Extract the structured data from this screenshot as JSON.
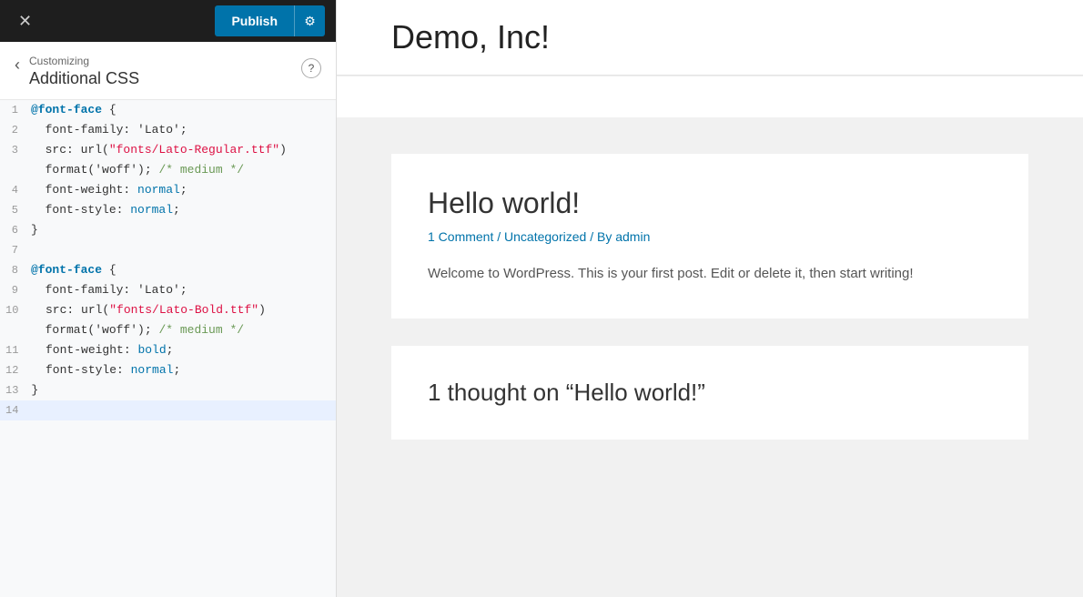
{
  "topbar": {
    "close_icon": "✕",
    "publish_label": "Publish",
    "settings_icon": "⚙"
  },
  "sidebar": {
    "customizing_label": "Customizing",
    "section_title": "Additional CSS",
    "back_icon": "‹",
    "help_icon": "?"
  },
  "code_editor": {
    "lines": [
      {
        "num": 1,
        "tokens": [
          {
            "type": "at",
            "text": "@font-face"
          },
          {
            "type": "plain",
            "text": " {"
          }
        ]
      },
      {
        "num": 2,
        "tokens": [
          {
            "type": "plain",
            "text": "  font-family: 'Lato';"
          }
        ]
      },
      {
        "num": 3,
        "tokens": [
          {
            "type": "plain",
            "text": "  src: url("
          },
          {
            "type": "string",
            "text": "\"fonts/Lato-Regular.ttf\""
          },
          {
            "type": "plain",
            "text": ")"
          },
          {
            "type": "plain",
            "text": ";"
          }
        ]
      },
      {
        "num": 3,
        "tokens": [
          {
            "type": "plain",
            "text": "  format('woff'); "
          },
          {
            "type": "comment",
            "text": "/* medium */"
          }
        ]
      },
      {
        "num": 4,
        "tokens": [
          {
            "type": "plain",
            "text": "  font-weight: "
          },
          {
            "type": "keyword",
            "text": "normal"
          },
          {
            "type": "plain",
            "text": ";"
          }
        ]
      },
      {
        "num": 5,
        "tokens": [
          {
            "type": "plain",
            "text": "  font-style: "
          },
          {
            "type": "keyword",
            "text": "normal"
          },
          {
            "type": "plain",
            "text": ";"
          }
        ]
      },
      {
        "num": 6,
        "tokens": [
          {
            "type": "plain",
            "text": "}"
          }
        ]
      },
      {
        "num": 7,
        "tokens": []
      },
      {
        "num": 8,
        "tokens": [
          {
            "type": "at",
            "text": "@font-face"
          },
          {
            "type": "plain",
            "text": " {"
          }
        ]
      },
      {
        "num": 9,
        "tokens": [
          {
            "type": "plain",
            "text": "  font-family: 'Lato';"
          }
        ]
      },
      {
        "num": 10,
        "tokens": [
          {
            "type": "plain",
            "text": "  src: url("
          },
          {
            "type": "string",
            "text": "\"fonts/Lato-Bold.ttf\""
          },
          {
            "type": "plain",
            "text": ")"
          },
          {
            "type": "plain",
            "text": ";"
          }
        ]
      },
      {
        "num": 10,
        "tokens": [
          {
            "type": "plain",
            "text": "  format('woff'); "
          },
          {
            "type": "comment",
            "text": "/* medium */"
          }
        ]
      },
      {
        "num": 11,
        "tokens": [
          {
            "type": "plain",
            "text": "  font-weight: "
          },
          {
            "type": "keyword",
            "text": "bold"
          },
          {
            "type": "plain",
            "text": ";"
          }
        ]
      },
      {
        "num": 12,
        "tokens": [
          {
            "type": "plain",
            "text": "  font-style: "
          },
          {
            "type": "keyword",
            "text": "normal"
          },
          {
            "type": "plain",
            "text": ";"
          }
        ]
      },
      {
        "num": 13,
        "tokens": [
          {
            "type": "plain",
            "text": "}"
          }
        ]
      },
      {
        "num": 14,
        "tokens": []
      }
    ]
  },
  "preview": {
    "site_title": "Demo, Inc!",
    "post_title": "Hello world!",
    "post_meta_comment": "1 Comment",
    "post_meta_sep1": " / ",
    "post_meta_category": "Uncategorized",
    "post_meta_sep2": " / By ",
    "post_meta_author": "admin",
    "post_excerpt": "Welcome to WordPress. This is your first post. Edit or delete it, then start writing!",
    "comments_title": "1 thought on “Hello world!”"
  }
}
